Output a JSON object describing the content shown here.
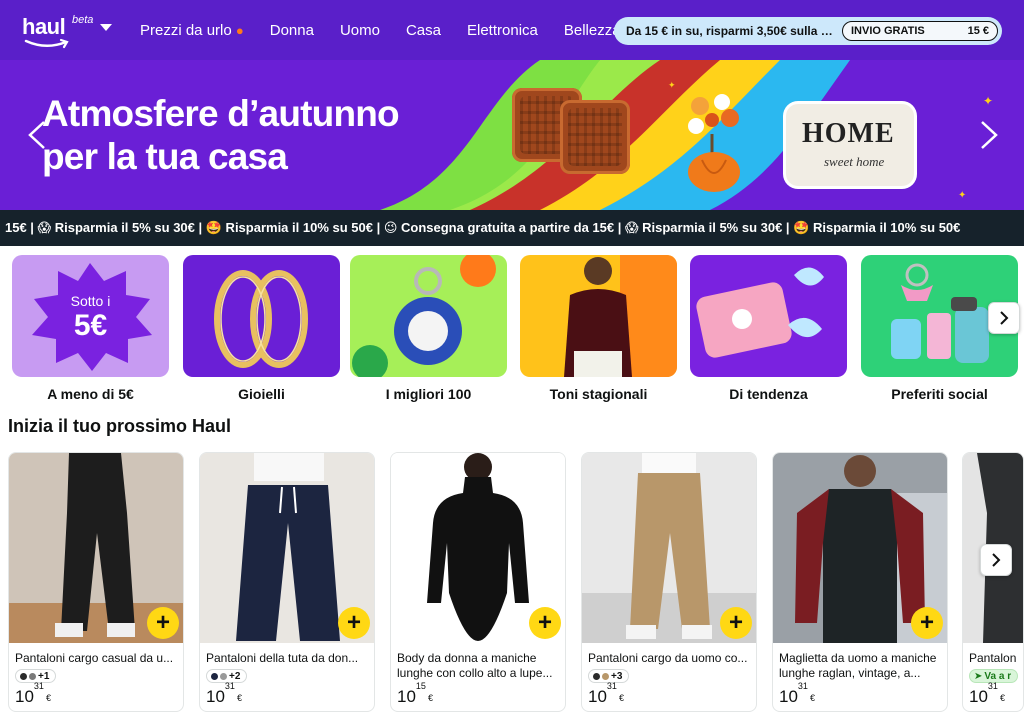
{
  "header": {
    "logo_word": "haul",
    "logo_beta": "beta",
    "nav": [
      {
        "label": "Prezzi da urlo",
        "icon": "flame-icon"
      },
      {
        "label": "Donna"
      },
      {
        "label": "Uomo"
      },
      {
        "label": "Casa"
      },
      {
        "label": "Elettronica"
      },
      {
        "label": "Bellezza"
      }
    ],
    "promo_text": "Da 15 € in su, risparmi 3,50€ sulla spe...",
    "promo_badge_label": "INVIO GRATIS",
    "promo_badge_value": "15 €"
  },
  "hero": {
    "title_line1": "Atmosfere d’autunno",
    "title_line2": "per la tua casa",
    "home_word": "HOME",
    "home_sub": "sweet home"
  },
  "ticker": {
    "text": "15€ | 😱 Risparmia il 5% su 30€ | 🤩 Risparmia il 10% su 50€ | 😉 Consegna gratuita a partire da 15€ | 😱 Risparmia il 5% su 30€ | 🤩 Risparmia il 10% su 50€"
  },
  "categories": [
    {
      "label": "A meno di 5€",
      "badge_line1": "Sotto i",
      "badge_line2": "5€"
    },
    {
      "label": "Gioielli"
    },
    {
      "label": "I migliori 100"
    },
    {
      "label": "Toni stagionali"
    },
    {
      "label": "Di tendenza"
    },
    {
      "label": "Preferiti social"
    }
  ],
  "section_title": "Inizia il tuo prossimo Haul",
  "products": [
    {
      "title": "Pantaloni cargo casual da u...",
      "swatch": "+1",
      "price_int": "10",
      "price_dec": "31",
      "currency": "€"
    },
    {
      "title": "Pantaloni della tuta da don...",
      "swatch": "+2",
      "price_int": "10",
      "price_dec": "31",
      "currency": "€"
    },
    {
      "title": "Body da donna a maniche lunghe con collo alto a lupe...",
      "price_int": "10",
      "price_dec": "15",
      "currency": "€"
    },
    {
      "title": "Pantaloni cargo da uomo co...",
      "swatch": "+3",
      "price_int": "10",
      "price_dec": "31",
      "currency": "€"
    },
    {
      "title": "Maglietta da uomo a maniche lunghe raglan, vintage, a...",
      "price_int": "10",
      "price_dec": "31",
      "currency": "€"
    },
    {
      "title": "Pantalon",
      "tag": "Va a r",
      "price_int": "10",
      "price_dec": "31",
      "currency": "€"
    }
  ],
  "colors": {
    "header_bg": "#5a1fc9",
    "hero_bg": "#6a1fd6",
    "ticker_bg": "#16222b",
    "promo_bg": "#cde8fb",
    "add_button": "#ffd814"
  }
}
